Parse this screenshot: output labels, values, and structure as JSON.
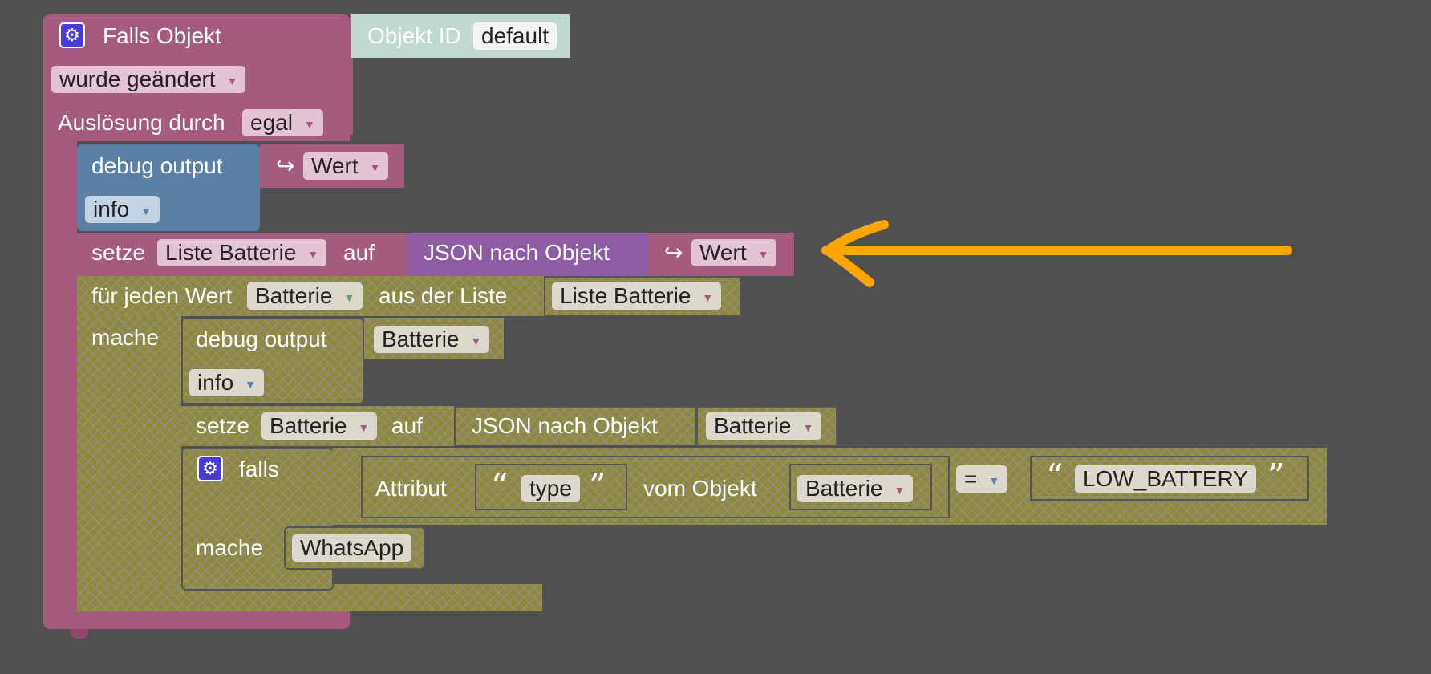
{
  "event_block": {
    "title": "Falls Objekt",
    "object_id_label": "Objekt ID",
    "object_id_value": "default",
    "condition": "wurde geändert",
    "trigger_label": "Auslösung durch",
    "trigger_value": "egal"
  },
  "debug1": {
    "label": "debug output",
    "arrow": "↪",
    "value": "Wert",
    "level": "info"
  },
  "set1": {
    "label": "setze",
    "variable": "Liste Batterie",
    "to": "auf",
    "json_label": "JSON nach Objekt",
    "arrow": "↪",
    "value": "Wert"
  },
  "foreach": {
    "label": "für jeden Wert",
    "variable": "Batterie",
    "from_label": "aus der Liste",
    "list": "Liste Batterie",
    "do_label": "mache"
  },
  "debug2": {
    "label": "debug output",
    "value": "Batterie",
    "level": "info"
  },
  "set2": {
    "label": "setze",
    "variable": "Batterie",
    "to": "auf",
    "json_label": "JSON nach Objekt",
    "value": "Batterie"
  },
  "if_block": {
    "label": "falls",
    "attr_label": "Attribut",
    "attr_value": "type",
    "from_object": "vom Objekt",
    "object": "Batterie",
    "operator": "=",
    "compare_value": "LOW_BATTERY",
    "do_label": "mache",
    "action": "WhatsApp"
  },
  "annotation": {
    "color": "#ffa500"
  }
}
